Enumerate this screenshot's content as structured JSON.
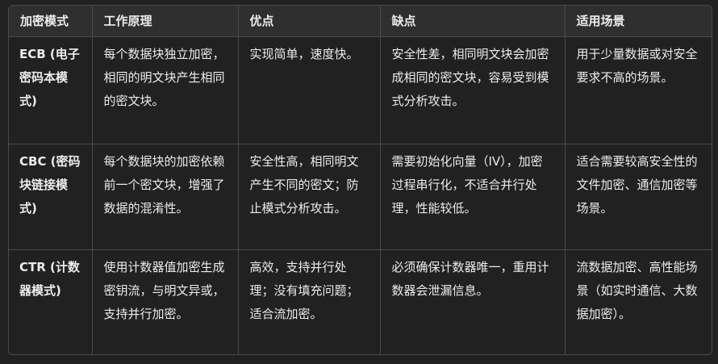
{
  "table": {
    "headers": [
      "加密模式",
      "工作原理",
      "优点",
      "缺点",
      "适用场景"
    ],
    "rows": [
      {
        "mode": "ECB (电子密码本模式)",
        "principle": "每个数据块独立加密，相同的明文块产生相同的密文块。",
        "pros": "实现简单，速度快。",
        "cons": "安全性差，相同明文块会加密成相同的密文块，容易受到模式分析攻击。",
        "scenario": "用于少量数据或对安全要求不高的场景。"
      },
      {
        "mode": "CBC (密码块链接模式)",
        "principle": "每个数据块的加密依赖前一个密文块，增强了数据的混淆性。",
        "pros": "安全性高，相同明文产生不同的密文；防止模式分析攻击。",
        "cons": "需要初始化向量（IV），加密过程串行化，不适合并行处理，性能较低。",
        "scenario": "适合需要较高安全性的文件加密、通信加密等场景。"
      },
      {
        "mode": "CTR (计数器模式)",
        "principle": "使用计数器值加密生成密钥流，与明文异或，支持并行加密。",
        "pros": "高效，支持并行处理；没有填充问题；适合流加密。",
        "cons": "必须确保计数器唯一，重用计数器会泄漏信息。",
        "scenario": "流数据加密、高性能场景（如实时通信、大数据加密）。"
      }
    ]
  }
}
